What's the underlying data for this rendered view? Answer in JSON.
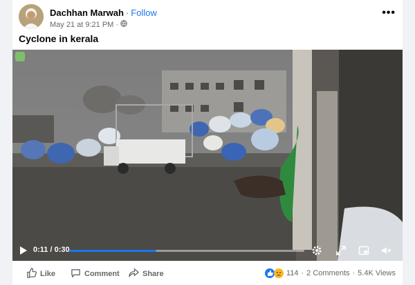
{
  "post": {
    "author": "Dachhan Marwah",
    "separator": "·",
    "follow_label": "Follow",
    "timestamp": "May 21 at 9:21 PM",
    "dot": "·",
    "audience_icon": "globe-icon",
    "more_label": "•••",
    "caption": "Cyclone in kerala"
  },
  "video": {
    "current_time": "0:11",
    "duration": "0:30",
    "time_separator": "/",
    "progress": 0.37,
    "controls": [
      "play-icon",
      "settings-icon",
      "expand-icon",
      "miniplayer-icon",
      "mute-icon"
    ]
  },
  "actions": {
    "like_label": "Like",
    "comment_label": "Comment",
    "share_label": "Share"
  },
  "stats": {
    "reactions_count": "114",
    "bullet": "·",
    "comments": "2 Comments",
    "views": "5.4K Views"
  },
  "colors": {
    "accent": "#1877f2",
    "secondary_text": "#65676b",
    "background": "#f0f2f5"
  }
}
